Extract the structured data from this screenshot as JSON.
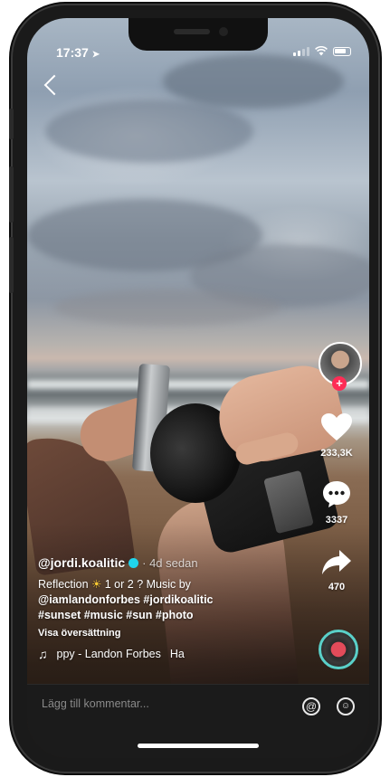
{
  "status_bar": {
    "time": "17:37",
    "location_glyph": "➤"
  },
  "video": {
    "username": "@jordi.koalitic",
    "posted": "· 4d sedan",
    "description_prefix": "Reflection ",
    "description_middle": " 1 or 2 ? Music by",
    "mention": "@iamlandonforbes",
    "hashtags_line1": "#jordikoalitic",
    "hashtags_line2": "#sunset #music #sun #photo",
    "translate": "Visa översättning",
    "music_text": "ppy - Landon Forbes",
    "music_text_2": "Ha",
    "sun_emoji": "☀"
  },
  "actions": {
    "follow": "+",
    "likes": "233,3K",
    "comments": "3337",
    "shares": "470"
  },
  "comment_bar": {
    "placeholder": "Lägg till kommentar...",
    "at_symbol": "@",
    "emoji_symbol": "☺"
  },
  "colors": {
    "accent_red": "#fe2c55",
    "verified_cyan": "#20d5ec"
  },
  "icons": [
    "back-icon",
    "heart-icon",
    "comment-icon",
    "share-icon",
    "music-note-icon",
    "at-icon",
    "emoji-icon",
    "verified-icon"
  ]
}
